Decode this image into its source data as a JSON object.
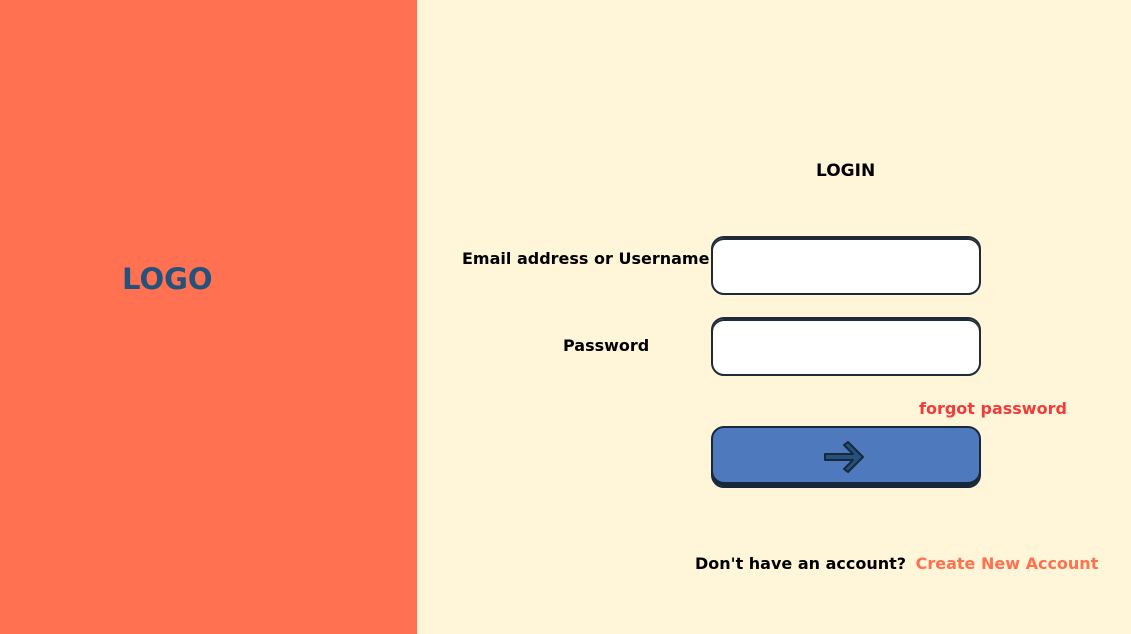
{
  "brand": {
    "logo_text": "LOGO",
    "colors": {
      "left_panel": "#ff7150",
      "right_panel": "#fff5d8",
      "logo": "#24527c",
      "button": "#4f79bd",
      "forgot_link": "#f23b3b",
      "create_link": "#ff7150"
    }
  },
  "login": {
    "title": "LOGIN",
    "email_label": "Email address or Username",
    "email_value": "",
    "password_label": "Password",
    "password_value": "",
    "forgot_label": "forgot password",
    "submit_icon": "arrow-right-icon",
    "signup_prompt": "Don't have an account?",
    "signup_link": "Create New Account"
  }
}
